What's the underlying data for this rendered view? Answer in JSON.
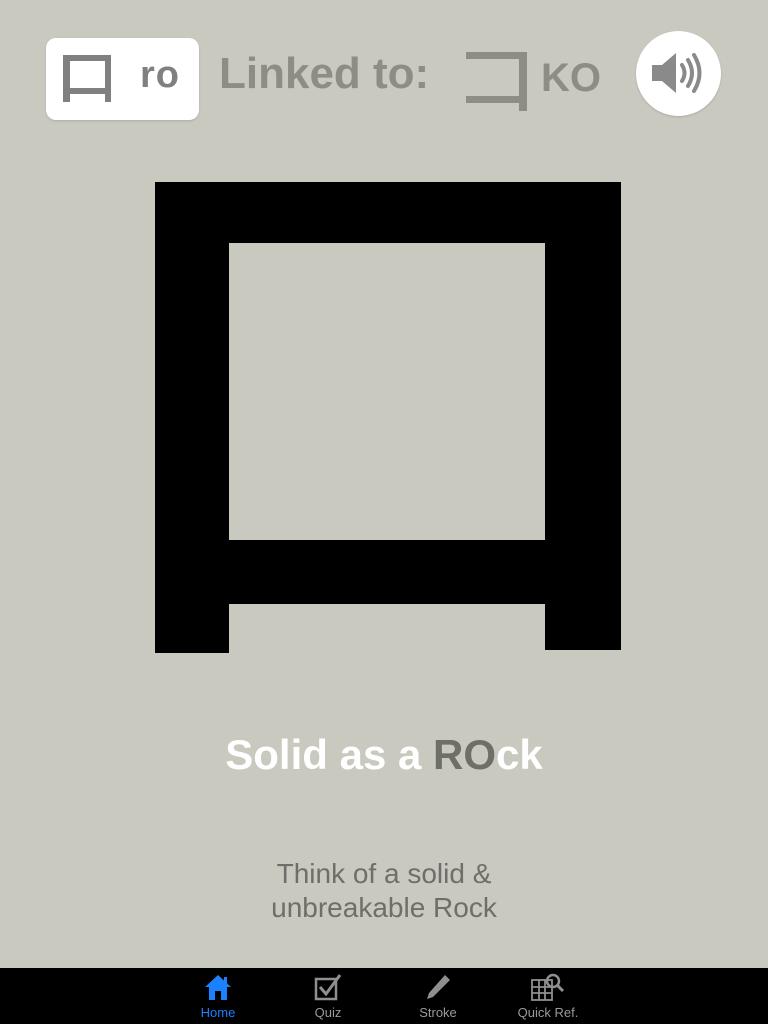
{
  "header": {
    "romaji": "ro",
    "linked_label": "Linked to:",
    "linked_romaji": "KO"
  },
  "mnemonic": {
    "prefix": "Solid as a ",
    "highlight": "RO",
    "suffix": "ck"
  },
  "hint": {
    "line1": "Think of a solid &",
    "line2": "unbreakable Rock"
  },
  "tabbar": {
    "tabs": [
      {
        "label": "Home",
        "icon": "home-icon",
        "active": true
      },
      {
        "label": "Quiz",
        "icon": "checkbox-icon",
        "active": false
      },
      {
        "label": "Stroke",
        "icon": "pencil-icon",
        "active": false
      },
      {
        "label": "Quick Ref.",
        "icon": "grid-search-icon",
        "active": false
      }
    ]
  },
  "colors": {
    "background": "#c9c9bf",
    "accent": "#1a82ff",
    "highlight_text": "#6f6f69"
  }
}
